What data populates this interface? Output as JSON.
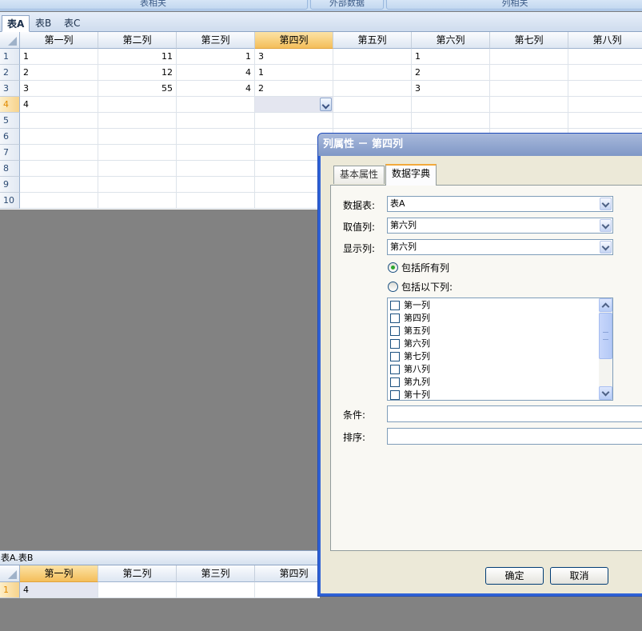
{
  "ribbon": {
    "groups": [
      "表相关",
      "外部数据",
      "列相关"
    ]
  },
  "sheet_tabs": [
    "表A",
    "表B",
    "表C"
  ],
  "grid": {
    "columns": [
      "第一列",
      "第二列",
      "第三列",
      "第四列",
      "第五列",
      "第六列",
      "第七列",
      "第八列"
    ],
    "row_numbers": [
      "1",
      "2",
      "3",
      "4",
      "5",
      "6",
      "7",
      "8",
      "9",
      "10"
    ],
    "rows": [
      [
        "1",
        "11",
        "1",
        "3",
        "",
        "1",
        "",
        ""
      ],
      [
        "2",
        "12",
        "4",
        "1",
        "",
        "2",
        "",
        ""
      ],
      [
        "3",
        "55",
        "4",
        "2",
        "",
        "3",
        "",
        ""
      ],
      [
        "4",
        "",
        "",
        "",
        "",
        "",
        "",
        ""
      ]
    ]
  },
  "bottom_panel": {
    "label": "表A.表B",
    "columns": [
      "第一列",
      "第二列",
      "第三列",
      "第四列"
    ],
    "row_numbers": [
      "1"
    ],
    "rows": [
      [
        "4",
        "",
        "",
        ""
      ]
    ]
  },
  "dialog": {
    "title": "列属性 － 第四列",
    "tabs": [
      "基本属性",
      "数据字典"
    ],
    "active_tab": "数据字典",
    "fields": {
      "table_label": "数据表:",
      "table_value": "表A",
      "value_col_label": "取值列:",
      "value_col_value": "第六列",
      "display_col_label": "显示列:",
      "display_col_value": "第六列",
      "radio_all": "包括所有列",
      "radio_some": "包括以下列:",
      "condition_label": "条件:",
      "condition_value": "",
      "sort_label": "排序:",
      "sort_value": ""
    },
    "column_list": [
      "第一列",
      "第四列",
      "第五列",
      "第六列",
      "第七列",
      "第八列",
      "第九列",
      "第十列"
    ],
    "ok_label": "确定",
    "cancel_label": "取消"
  }
}
